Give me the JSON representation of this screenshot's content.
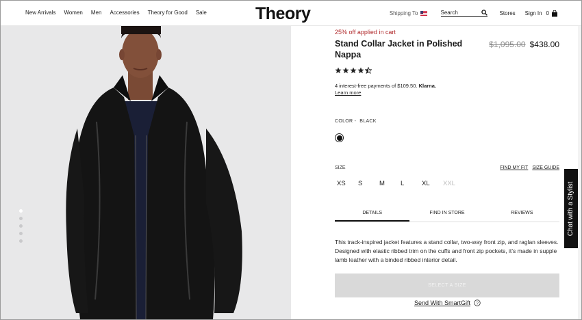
{
  "header": {
    "nav": [
      "New Arrivals",
      "Women",
      "Men",
      "Accessories",
      "Theory for Good",
      "Sale"
    ],
    "logo": "Theory",
    "shipping_label": "Shipping To",
    "search_placeholder": "Search",
    "stores_label": "Stores",
    "signin_label": "Sign In",
    "bag_count": "0"
  },
  "gallery": {
    "dots_count": 5,
    "active_index": 0
  },
  "product": {
    "promo": "25% off applied in cart",
    "title": "Stand Collar Jacket in Polished Nappa",
    "price_original": "$1,095.00",
    "price_sale": "$438.00",
    "rating": 4.5,
    "rating_max": 5,
    "klarna_text": "4 interest-free payments of $109.50.",
    "klarna_brand": "Klarna.",
    "klarna_learn": "Learn more",
    "color_label": "COLOR -",
    "color_value": "BLACK",
    "size_label": "SIZE",
    "find_my_fit": "FIND MY FIT",
    "size_guide": "SIZE GUIDE",
    "sizes": [
      {
        "label": "XS",
        "available": true
      },
      {
        "label": "S",
        "available": true
      },
      {
        "label": "M",
        "available": true
      },
      {
        "label": "L",
        "available": true
      },
      {
        "label": "XL",
        "available": true
      },
      {
        "label": "XXL",
        "available": false
      }
    ],
    "tabs": [
      {
        "label": "DETAILS",
        "active": true
      },
      {
        "label": "FIND IN STORE",
        "active": false
      },
      {
        "label": "REVIEWS",
        "active": false
      }
    ],
    "description": "This track-inspired jacket features a stand collar, two-way front zip, and raglan sleeves. Designed with elastic ribbed trim on the cuffs and front zip pockets, it’s made in supple lamb leather with a binded ribbed interior detail.",
    "cta_label": "SELECT A SIZE",
    "smartgift_label": "Send With SmartGift"
  },
  "chat": {
    "label": "Chat with a Stylist"
  },
  "colors": {
    "promo": "#b0282a",
    "cta_bg": "#d9d9d9",
    "image_bg": "#e8e8e9"
  }
}
